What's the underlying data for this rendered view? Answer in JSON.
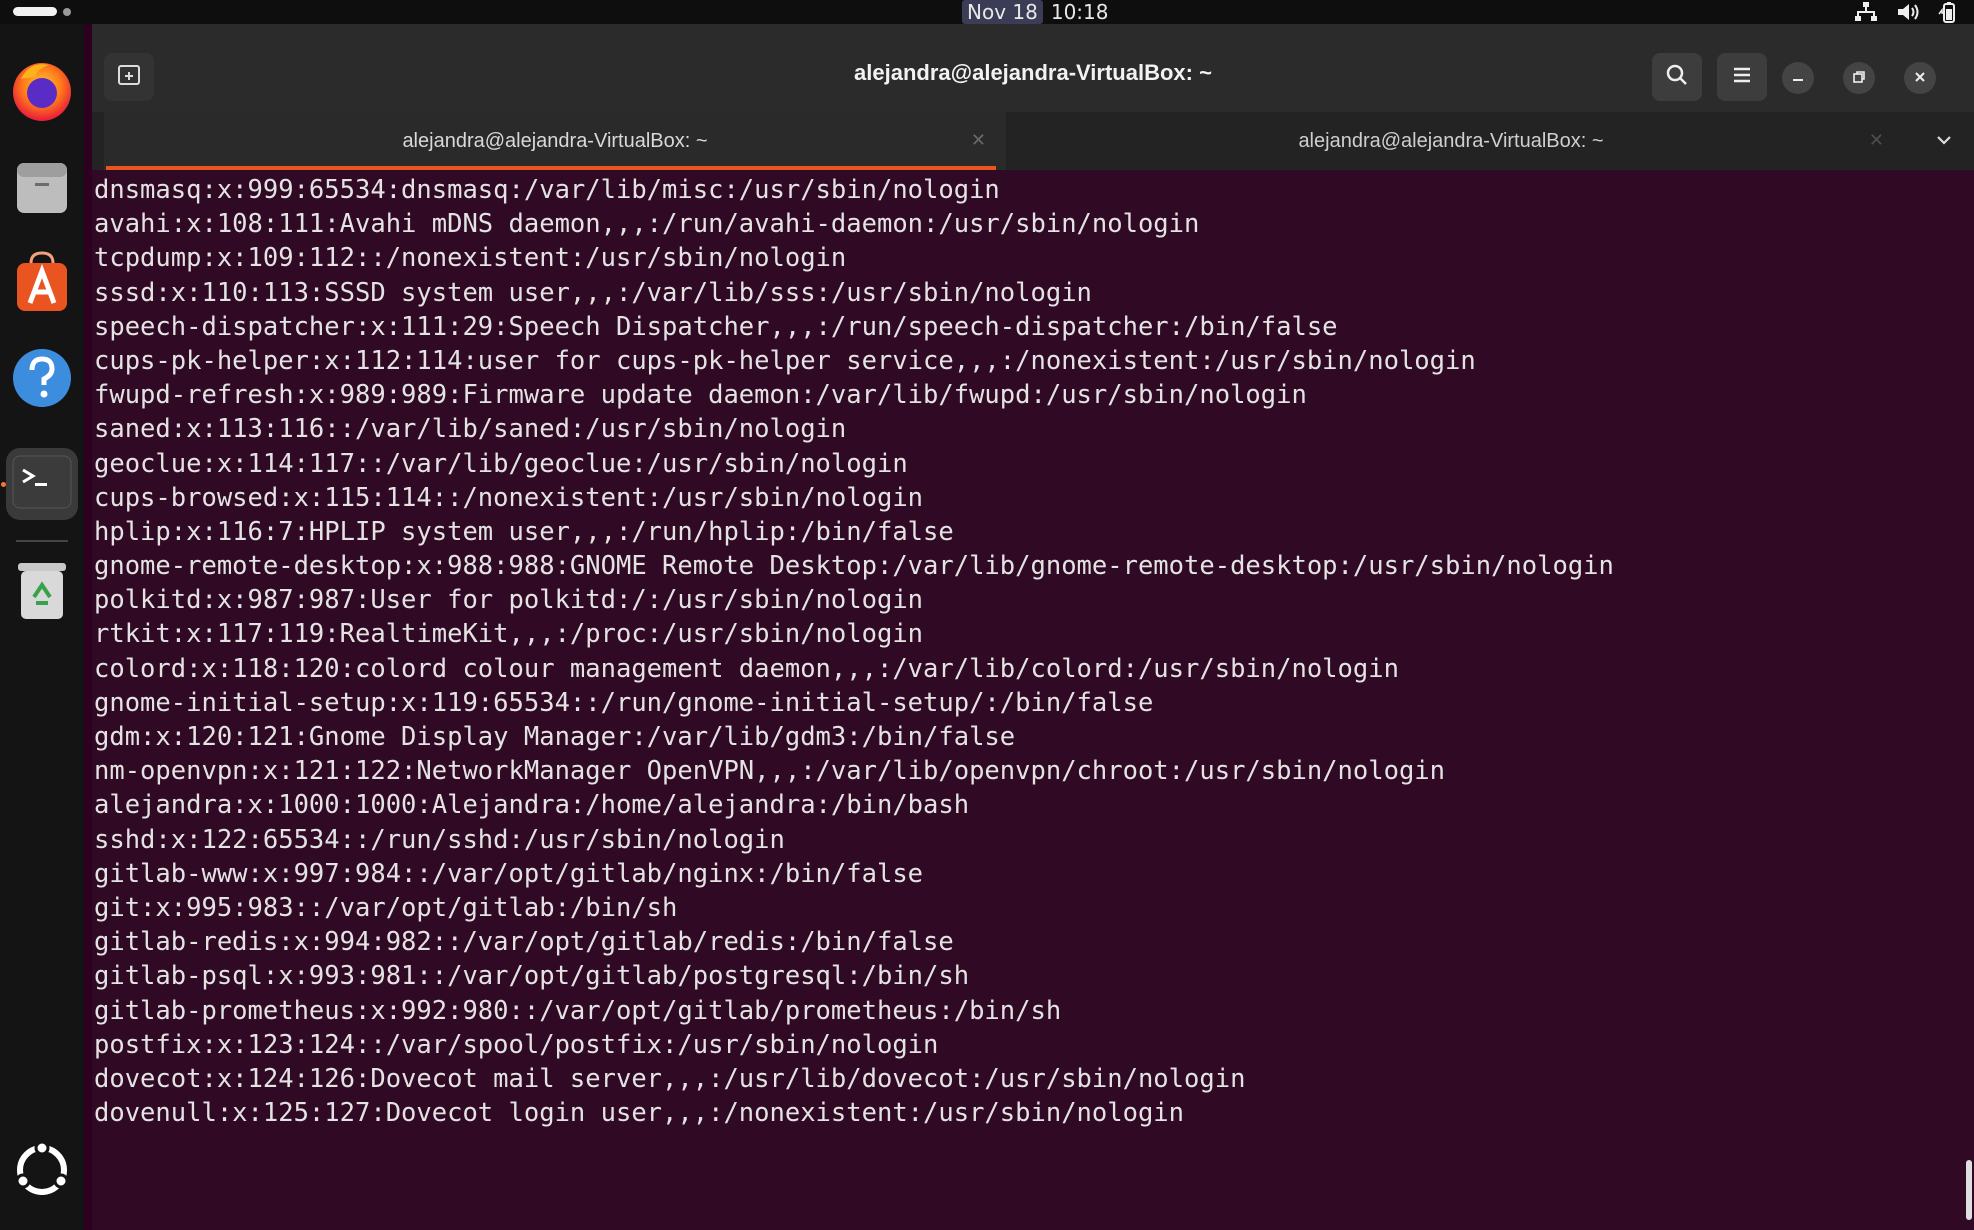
{
  "top_bar": {
    "date": "Nov 18",
    "time": "10:18",
    "tray_icons": [
      "network-icon",
      "volume-icon",
      "battery-icon"
    ]
  },
  "dock": {
    "apps": [
      {
        "name": "firefox-icon"
      },
      {
        "name": "files-icon"
      },
      {
        "name": "app-center-icon"
      },
      {
        "name": "help-icon"
      },
      {
        "name": "terminal-icon",
        "active": true
      },
      {
        "name": "trash-icon"
      }
    ],
    "bottom": "show-apps-icon"
  },
  "window": {
    "title": "alejandra@alejandra-VirtualBox: ~",
    "tabs": [
      {
        "label": "alejandra@alejandra-VirtualBox: ~",
        "active": true
      },
      {
        "label": "alejandra@alejandra-VirtualBox: ~",
        "active": false
      }
    ]
  },
  "terminal": {
    "lines": [
      "dnsmasq:x:999:65534:dnsmasq:/var/lib/misc:/usr/sbin/nologin",
      "avahi:x:108:111:Avahi mDNS daemon,,,:/run/avahi-daemon:/usr/sbin/nologin",
      "tcpdump:x:109:112::/nonexistent:/usr/sbin/nologin",
      "sssd:x:110:113:SSSD system user,,,:/var/lib/sss:/usr/sbin/nologin",
      "speech-dispatcher:x:111:29:Speech Dispatcher,,,:/run/speech-dispatcher:/bin/false",
      "cups-pk-helper:x:112:114:user for cups-pk-helper service,,,:/nonexistent:/usr/sbin/nologin",
      "fwupd-refresh:x:989:989:Firmware update daemon:/var/lib/fwupd:/usr/sbin/nologin",
      "saned:x:113:116::/var/lib/saned:/usr/sbin/nologin",
      "geoclue:x:114:117::/var/lib/geoclue:/usr/sbin/nologin",
      "cups-browsed:x:115:114::/nonexistent:/usr/sbin/nologin",
      "hplip:x:116:7:HPLIP system user,,,:/run/hplip:/bin/false",
      "gnome-remote-desktop:x:988:988:GNOME Remote Desktop:/var/lib/gnome-remote-desktop:/usr/sbin/nologin",
      "polkitd:x:987:987:User for polkitd:/:/usr/sbin/nologin",
      "rtkit:x:117:119:RealtimeKit,,,:/proc:/usr/sbin/nologin",
      "colord:x:118:120:colord colour management daemon,,,:/var/lib/colord:/usr/sbin/nologin",
      "gnome-initial-setup:x:119:65534::/run/gnome-initial-setup/:/bin/false",
      "gdm:x:120:121:Gnome Display Manager:/var/lib/gdm3:/bin/false",
      "nm-openvpn:x:121:122:NetworkManager OpenVPN,,,:/var/lib/openvpn/chroot:/usr/sbin/nologin",
      "alejandra:x:1000:1000:Alejandra:/home/alejandra:/bin/bash",
      "sshd:x:122:65534::/run/sshd:/usr/sbin/nologin",
      "gitlab-www:x:997:984::/var/opt/gitlab/nginx:/bin/false",
      "git:x:995:983::/var/opt/gitlab:/bin/sh",
      "gitlab-redis:x:994:982::/var/opt/gitlab/redis:/bin/false",
      "gitlab-psql:x:993:981::/var/opt/gitlab/postgresql:/bin/sh",
      "gitlab-prometheus:x:992:980::/var/opt/gitlab/prometheus:/bin/sh",
      "postfix:x:123:124::/var/spool/postfix:/usr/sbin/nologin",
      "dovecot:x:124:126:Dovecot mail server,,,:/usr/lib/dovecot:/usr/sbin/nologin",
      "dovenull:x:125:127:Dovecot login user,,,:/nonexistent:/usr/sbin/nologin"
    ]
  },
  "colors": {
    "terminal_bg": "#300a24",
    "terminal_fg": "#e3e3e3",
    "accent": "#e95420"
  }
}
